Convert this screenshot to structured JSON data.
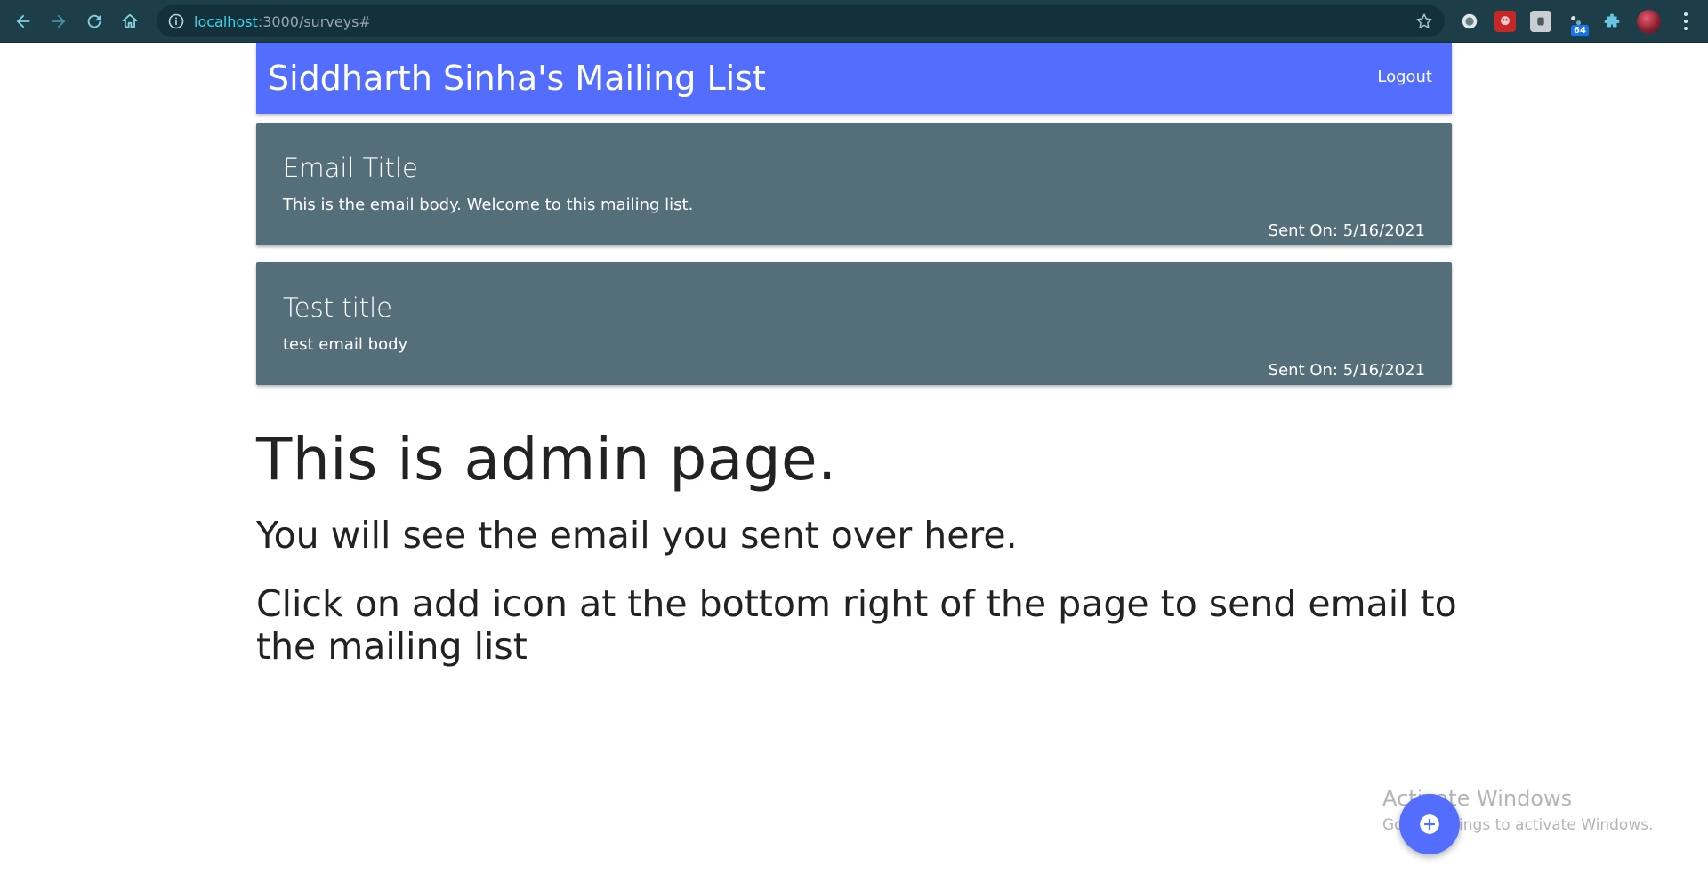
{
  "browser": {
    "url_host": "localhost",
    "url_rest": ":3000/surveys#",
    "extension_badge": "64"
  },
  "header": {
    "brand_title": "Siddharth Sinha's Mailing List",
    "logout_label": "Logout"
  },
  "emails": [
    {
      "title": "Email Title",
      "body": "This is the email body. Welcome to this mailing list.",
      "sent_on": "Sent On: 5/16/2021"
    },
    {
      "title": "Test title",
      "body": "test email body",
      "sent_on": "Sent On: 5/16/2021"
    }
  ],
  "main": {
    "heading": "This is admin page.",
    "subheading": "You will see the email you sent over here.",
    "instruction": "Click on add icon at the bottom right of the page to send email to the mailing list"
  },
  "watermark": {
    "line1": "Activate Windows",
    "line2": "Go to Settings to activate Windows."
  },
  "colors": {
    "header_bg": "#536dfe",
    "card_bg": "#546e7a",
    "browser_bg": "#1d3d49",
    "fab_bg": "#536dfe"
  },
  "icons": {
    "fab": "add-icon"
  }
}
